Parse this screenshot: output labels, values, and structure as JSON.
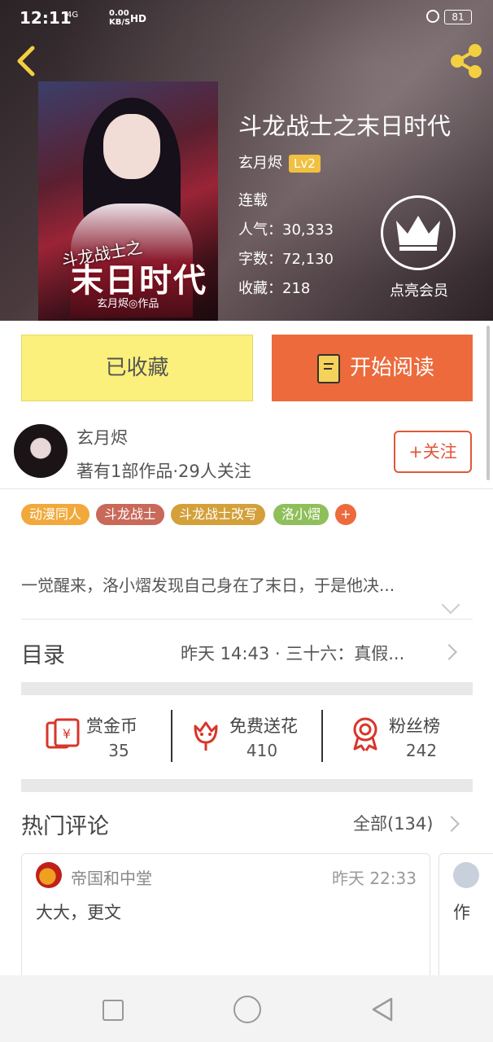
{
  "status": {
    "time": "12:11",
    "network": "4G",
    "speed_value": "0.00",
    "speed_unit": "KB/S",
    "hd": "HD",
    "battery": "81"
  },
  "book": {
    "title": "斗龙战士之末日时代",
    "author": "玄月烬",
    "level": "Lv2",
    "status": "连载",
    "popularity_label": "人气：",
    "popularity": "30,333",
    "words_label": "字数：",
    "words": "72,130",
    "favorites_label": "收藏：",
    "favorites": "218",
    "vip_label": "点亮会员",
    "cover_title_small": "斗龙战士之",
    "cover_title_big": "末日时代",
    "cover_author": "玄月烬◎作品"
  },
  "actions": {
    "favorited_label": "已收藏",
    "read_label": "开始阅读"
  },
  "author_card": {
    "name": "玄月烬",
    "meta": "著有1部作品·29人关注",
    "follow_label": "+关注"
  },
  "tags": [
    {
      "label": "动漫同人",
      "color": "#f2a93b"
    },
    {
      "label": "斗龙战士",
      "color": "#c8695a"
    },
    {
      "label": "斗龙战士改写",
      "color": "#d3a03a"
    },
    {
      "label": "洛小熠",
      "color": "#8fbf5a"
    }
  ],
  "tag_more": "+",
  "intro": "一觉醒来，洛小熠发现自己身在了末日，于是他决...",
  "toc": {
    "label": "目录",
    "latest": "昨天 14:43 · 三十六：真假..."
  },
  "stats": [
    {
      "label": "赏金币",
      "value": "35",
      "icon": "red-envelope-icon"
    },
    {
      "label": "免费送花",
      "value": "410",
      "icon": "flower-icon"
    },
    {
      "label": "粉丝榜",
      "value": "242",
      "icon": "medal-icon"
    }
  ],
  "hot_comments": {
    "title": "热门评论",
    "all_label": "全部(134)",
    "items": [
      {
        "user": "帝国和中堂",
        "time": "昨天 22:33",
        "text": "大大，更文"
      },
      {
        "user": "",
        "time": "",
        "text": "作"
      }
    ]
  },
  "colors": {
    "accent": "#ec6a3c",
    "favorite_button": "#fbf07b",
    "follow": "#e0573a",
    "icon_red": "#d9352a"
  }
}
